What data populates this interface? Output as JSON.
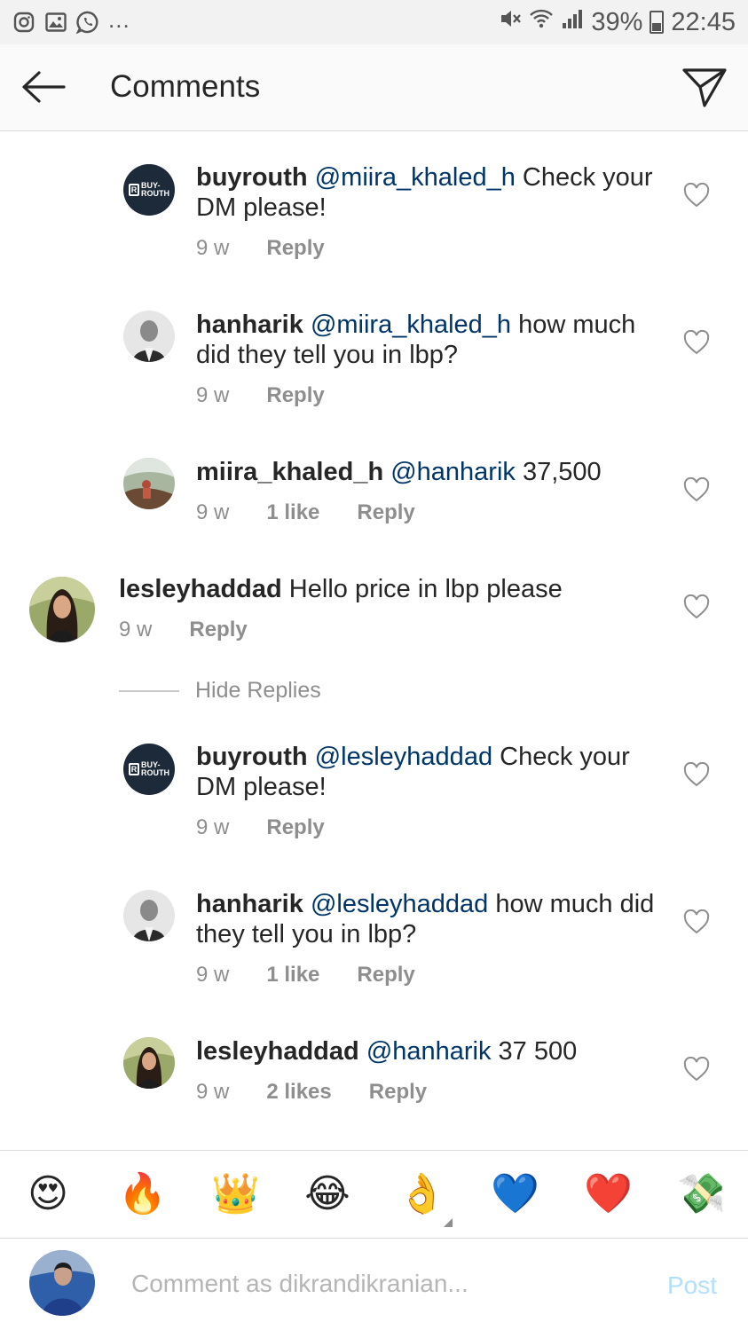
{
  "status_bar": {
    "left_icons": [
      "instagram-icon",
      "gallery-icon",
      "whatsapp-icon"
    ],
    "more": "...",
    "battery": "39%",
    "time": "22:45"
  },
  "header": {
    "title": "Comments"
  },
  "comments": [
    {
      "user": "buyrouth",
      "mention": "@miira_khaled_h",
      "text": " Check your DM please!",
      "time": "9 w",
      "likes": "",
      "reply": "Reply",
      "avatar": "buyrouth-logo"
    },
    {
      "user": "hanharik",
      "mention": "@miira_khaled_h",
      "text": " how much did they tell you in lbp?",
      "time": "9 w",
      "likes": "",
      "reply": "Reply",
      "avatar": "hanharik"
    },
    {
      "user": "miira_khaled_h",
      "mention": "@hanharik",
      "text": " 37,500",
      "time": "9 w",
      "likes": "1 like",
      "reply": "Reply",
      "avatar": "miira"
    },
    {
      "user": "lesleyhaddad",
      "mention": "",
      "text": " Hello price in lbp please",
      "time": "9 w",
      "likes": "",
      "reply": "Reply",
      "avatar": "lesley"
    },
    {
      "user": "buyrouth",
      "mention": "@lesleyhaddad",
      "text": " Check your DM please!",
      "time": "9 w",
      "likes": "",
      "reply": "Reply",
      "avatar": "buyrouth-logo"
    },
    {
      "user": "hanharik",
      "mention": "@lesleyhaddad",
      "text": " how much did they tell you in lbp?",
      "time": "9 w",
      "likes": "1 like",
      "reply": "Reply",
      "avatar": "hanharik"
    },
    {
      "user": "lesleyhaddad",
      "mention": "@hanharik",
      "text": " 37 500",
      "time": "9 w",
      "likes": "2 likes",
      "reply": "Reply",
      "avatar": "lesley"
    }
  ],
  "brand_logo": {
    "top": "BUY-",
    "bottom": "ROUTH"
  },
  "hide_replies": "Hide Replies",
  "emojis": [
    "😍",
    "🔥",
    "👑",
    "😂",
    "👌",
    "💙",
    "❤️",
    "💸"
  ],
  "composer": {
    "placeholder": "Comment as dikrandikranian...",
    "post_label": "Post"
  },
  "colors": {
    "mention": "#003569",
    "meta": "#8e8e8e",
    "post": "#b2dffc"
  }
}
